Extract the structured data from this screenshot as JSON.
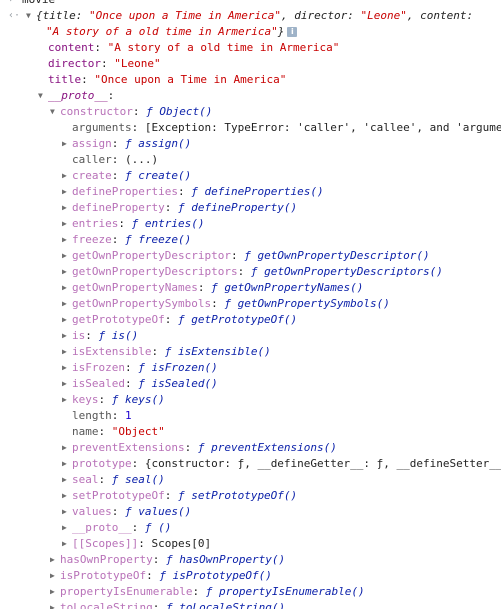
{
  "header": {
    "input_label": "movie"
  },
  "summary": {
    "open": "{title: ",
    "title_val": "\"Once upon a Time in America\"",
    "sep1": ", director: ",
    "director_val": "\"Leone\"",
    "sep2": ", content:",
    "content_val": "\"A story of a old time in Armerica\"",
    "close": "}",
    "info": "i"
  },
  "props": [
    {
      "key": "content",
      "colon": ": ",
      "value": "\"A story of a old time in Armerica\""
    },
    {
      "key": "director",
      "colon": ": ",
      "value": "\"Leone\""
    },
    {
      "key": "title",
      "colon": ": ",
      "value": "\"Once upon a Time in America\""
    }
  ],
  "proto": {
    "label": "__proto__",
    "colon": ":",
    "constructor_key": "constructor",
    "constructor_val": "ƒ Object()"
  },
  "object_members": [
    {
      "key": "arguments",
      "val": "[Exception: TypeError: 'caller', 'callee', and 'argume",
      "kind": "plain",
      "expand": false
    },
    {
      "key": "assign",
      "val": "ƒ assign()",
      "kind": "fn",
      "expand": true
    },
    {
      "key": "caller",
      "val": "(...)",
      "kind": "plain",
      "expand": false
    },
    {
      "key": "create",
      "val": "ƒ create()",
      "kind": "fn",
      "expand": true
    },
    {
      "key": "defineProperties",
      "val": "ƒ defineProperties()",
      "kind": "fn",
      "expand": true
    },
    {
      "key": "defineProperty",
      "val": "ƒ defineProperty()",
      "kind": "fn",
      "expand": true
    },
    {
      "key": "entries",
      "val": "ƒ entries()",
      "kind": "fn",
      "expand": true
    },
    {
      "key": "freeze",
      "val": "ƒ freeze()",
      "kind": "fn",
      "expand": true
    },
    {
      "key": "getOwnPropertyDescriptor",
      "val": "ƒ getOwnPropertyDescriptor()",
      "kind": "fn",
      "expand": true
    },
    {
      "key": "getOwnPropertyDescriptors",
      "val": "ƒ getOwnPropertyDescriptors()",
      "kind": "fn",
      "expand": true
    },
    {
      "key": "getOwnPropertyNames",
      "val": "ƒ getOwnPropertyNames()",
      "kind": "fn",
      "expand": true
    },
    {
      "key": "getOwnPropertySymbols",
      "val": "ƒ getOwnPropertySymbols()",
      "kind": "fn",
      "expand": true
    },
    {
      "key": "getPrototypeOf",
      "val": "ƒ getPrototypeOf()",
      "kind": "fn",
      "expand": true
    },
    {
      "key": "is",
      "val": "ƒ is()",
      "kind": "fn",
      "expand": true
    },
    {
      "key": "isExtensible",
      "val": "ƒ isExtensible()",
      "kind": "fn",
      "expand": true
    },
    {
      "key": "isFrozen",
      "val": "ƒ isFrozen()",
      "kind": "fn",
      "expand": true
    },
    {
      "key": "isSealed",
      "val": "ƒ isSealed()",
      "kind": "fn",
      "expand": true
    },
    {
      "key": "keys",
      "val": "ƒ keys()",
      "kind": "fn",
      "expand": true
    },
    {
      "key": "length",
      "val": "1",
      "kind": "num",
      "expand": false
    },
    {
      "key": "name",
      "val": "\"Object\"",
      "kind": "str",
      "expand": false
    },
    {
      "key": "preventExtensions",
      "val": "ƒ preventExtensions()",
      "kind": "fn",
      "expand": true
    },
    {
      "key": "prototype",
      "val": "{constructor: ƒ, __defineGetter__: ƒ, __defineSetter__",
      "kind": "plain",
      "expand": true
    },
    {
      "key": "seal",
      "val": "ƒ seal()",
      "kind": "fn",
      "expand": true
    },
    {
      "key": "setPrototypeOf",
      "val": "ƒ setPrototypeOf()",
      "kind": "fn",
      "expand": true
    },
    {
      "key": "values",
      "val": "ƒ values()",
      "kind": "fn",
      "expand": true
    },
    {
      "key": "__proto__",
      "val": "ƒ ()",
      "kind": "fn",
      "expand": true
    },
    {
      "key": "[[Scopes]]",
      "val": "Scopes[0]",
      "kind": "plain",
      "expand": true
    }
  ],
  "proto_members": [
    {
      "key": "hasOwnProperty",
      "val": "ƒ hasOwnProperty()"
    },
    {
      "key": "isPrototypeOf",
      "val": "ƒ isPrototypeOf()"
    },
    {
      "key": "propertyIsEnumerable",
      "val": "ƒ propertyIsEnumerable()"
    },
    {
      "key": "toLocaleString",
      "val": "ƒ toLocaleString()"
    }
  ],
  "colors": {
    "key": "#881280",
    "string": "#c80000",
    "function": "#0d22aa",
    "number": "#1c00cf"
  }
}
